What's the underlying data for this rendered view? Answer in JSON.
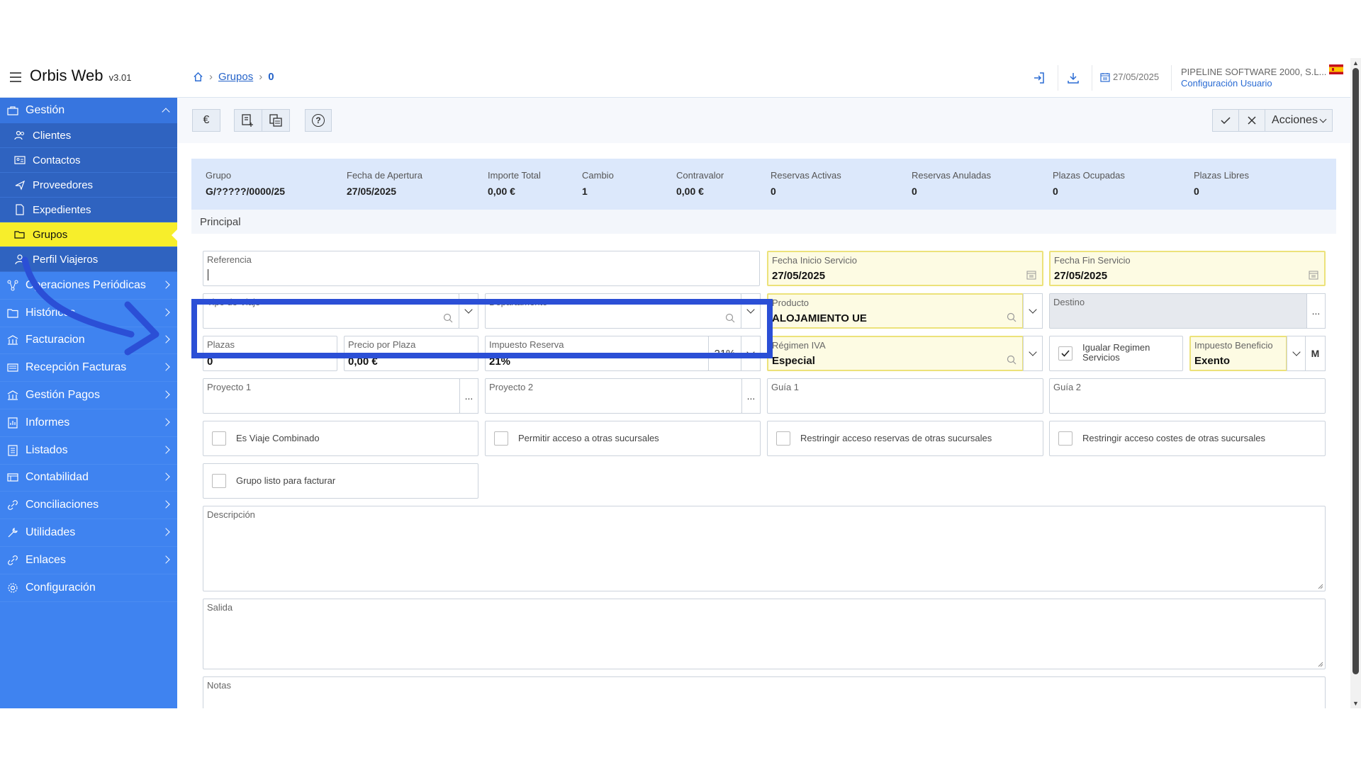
{
  "header": {
    "app_name": "Orbis Web",
    "version": "v3.01",
    "breadcrumb": [
      "Grupos",
      "0"
    ],
    "date": "27/05/2025",
    "company": "PIPELINE SOFTWARE 2000, S.L...",
    "config_link": "Configuración Usuario"
  },
  "sidebar": {
    "section": "Gestión",
    "sub_items": [
      "Clientes",
      "Contactos",
      "Proveedores",
      "Expedientes",
      "Grupos",
      "Perfil Viajeros"
    ],
    "items": [
      "Operaciones Periódicas",
      "Históricos",
      "Facturacion",
      "Recepción Facturas",
      "Gestión Pagos",
      "Informes",
      "Listados",
      "Contabilidad",
      "Conciliaciones",
      "Utilidades",
      "Enlaces",
      "Configuración"
    ]
  },
  "toolbar": {
    "euro": "€",
    "help": "?",
    "acciones": "Acciones"
  },
  "summary": [
    {
      "label": "Grupo",
      "value": "G/?????/0000/25"
    },
    {
      "label": "Fecha de Apertura",
      "value": "27/05/2025"
    },
    {
      "label": "Importe Total",
      "value": "0,00 €"
    },
    {
      "label": "Cambio",
      "value": "1"
    },
    {
      "label": "Contravalor",
      "value": "0,00 €"
    },
    {
      "label": "Reservas Activas",
      "value": "0"
    },
    {
      "label": "Reservas Anuladas",
      "value": "0"
    },
    {
      "label": "Plazas Ocupadas",
      "value": "0"
    },
    {
      "label": "Plazas Libres",
      "value": "0"
    }
  ],
  "form": {
    "section": "Principal",
    "referencia": {
      "label": "Referencia",
      "value": ""
    },
    "fecha_inicio": {
      "label": "Fecha Inicio Servicio",
      "value": "27/05/2025"
    },
    "fecha_fin": {
      "label": "Fecha Fin Servicio",
      "value": "27/05/2025"
    },
    "tipo_viaje": {
      "label": "Tipo de Viaje",
      "value": ""
    },
    "departamento": {
      "label": "Departamento",
      "value": ""
    },
    "producto": {
      "label": "Producto",
      "value": "ALOJAMIENTO UE"
    },
    "destino": {
      "label": "Destino",
      "value": ""
    },
    "plazas": {
      "label": "Plazas",
      "value": "0"
    },
    "precio_plaza": {
      "label": "Precio por Plaza",
      "value": "0,00 €"
    },
    "impuesto_reserva": {
      "label": "Impuesto Reserva",
      "value": "21%",
      "rate": "21%"
    },
    "regimen_iva": {
      "label": "Régimen IVA",
      "value": "Especial"
    },
    "igualar_regimen": {
      "label_line1": "Igualar Regimen",
      "label_line2": "Servicios",
      "checked": true
    },
    "impuesto_beneficio": {
      "label": "Impuesto Beneficio",
      "value": "Exento",
      "m": "M"
    },
    "proyecto1": {
      "label": "Proyecto 1",
      "value": ""
    },
    "proyecto2": {
      "label": "Proyecto 2",
      "value": ""
    },
    "guia1": {
      "label": "Guía 1",
      "value": ""
    },
    "guia2": {
      "label": "Guía 2",
      "value": ""
    },
    "checkboxes": [
      "Es Viaje Combinado",
      "Permitir acceso a otras sucursales",
      "Restringir acceso reservas de otras sucursales",
      "Restringir acceso costes de otras sucursales"
    ],
    "grupo_listo": "Grupo listo para facturar",
    "descripcion": "Descripción",
    "salida": "Salida",
    "notas": "Notas",
    "dots": "..."
  },
  "colors": {
    "sidebar": "#3f83f0",
    "active": "#f7ee2b",
    "highlight": "#2b4fd6"
  }
}
